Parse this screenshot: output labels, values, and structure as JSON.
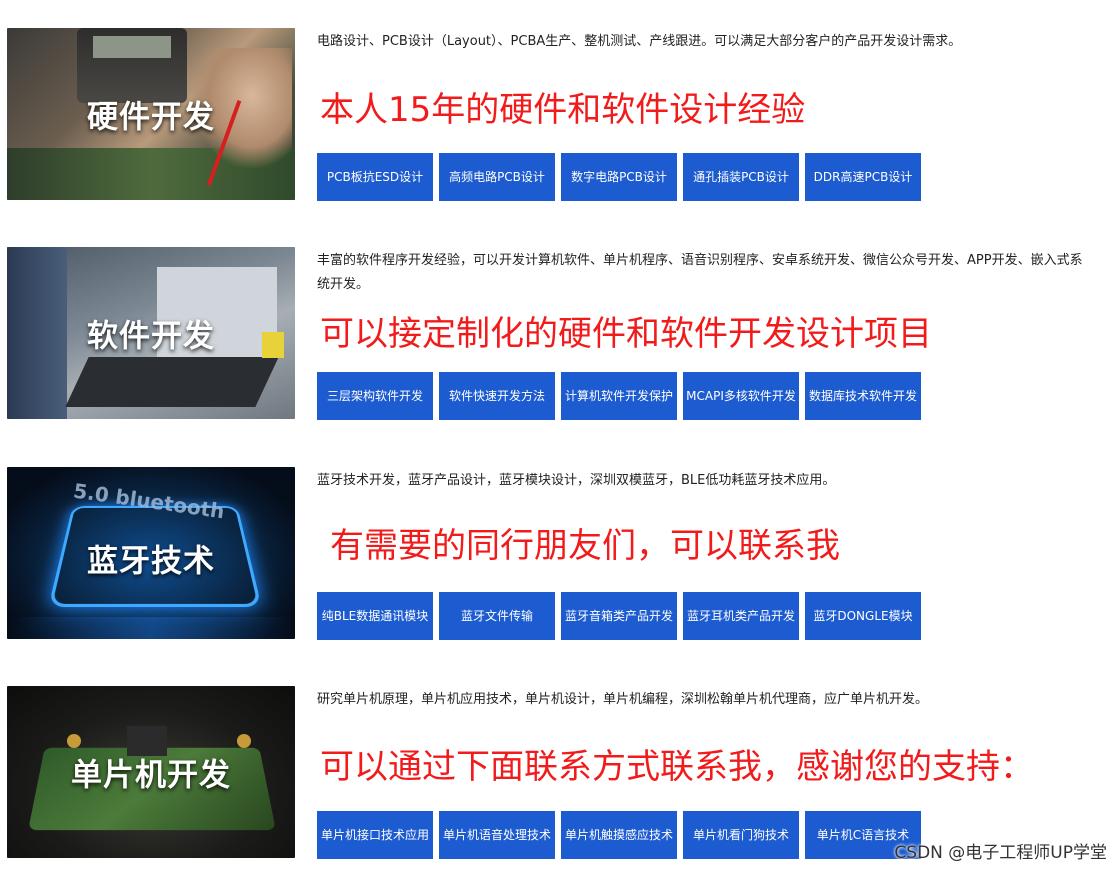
{
  "sections": [
    {
      "title": "硬件开发",
      "description": "电路设计、PCB设计（Layout）、PCBA生产、整机测试、产线跟进。可以满足大部分客户的产品开发设计需求。",
      "highlight": "本人15年的硬件和软件设计经验",
      "tags": [
        "PCB板抗ESD设计",
        "高频电路PCB设计",
        "数字电路PCB设计",
        "通孔插装PCB设计",
        "DDR高速PCB设计"
      ]
    },
    {
      "title": "软件开发",
      "description": "丰富的软件程序开发经验，可以开发计算机软件、单片机程序、语音识别程序、安卓系统开发、微信公众号开发、APP开发、嵌入式系统开发。",
      "highlight": "可以接定制化的硬件和软件开发设计项目",
      "tags": [
        "三层架构软件开发",
        "软件快速开发方法",
        "计算机软件开发保护",
        "MCAPI多核软件开发",
        "数据库技术软件开发"
      ]
    },
    {
      "title": "蓝牙技术",
      "description": "蓝牙技术开发，蓝牙产品设计，蓝牙模块设计，深圳双模蓝牙，BLE低功耗蓝牙技术应用。",
      "highlight": "有需要的同行朋友们，可以联系我",
      "image_text": "5.0 bluetooth",
      "tags": [
        "纯BLE数据通讯模块",
        "蓝牙文件传输",
        "蓝牙音箱类产品开发",
        "蓝牙耳机类产品开发",
        "蓝牙DONGLE模块"
      ]
    },
    {
      "title": "单片机开发",
      "description": "研究单片机原理，单片机应用技术，单片机设计，单片机编程，深圳松翰单片机代理商，应广单片机开发。",
      "highlight": "可以通过下面联系方式联系我，感谢您的支持：",
      "tags": [
        "单片机接口技术应用",
        "单片机语音处理技术",
        "单片机触摸感应技术",
        "单片机看门狗技术",
        "单片机C语言技术"
      ]
    }
  ],
  "watermark": "CSDN @电子工程师UP学堂",
  "colors": {
    "highlight": "#f21b1b",
    "tag_bg": "#1d5bd0",
    "tag_text": "#ffffff"
  },
  "icons": [
    "multimeter-probe-image",
    "keyboard-typing-image",
    "bluetooth-chip-image",
    "pcb-board-image"
  ]
}
